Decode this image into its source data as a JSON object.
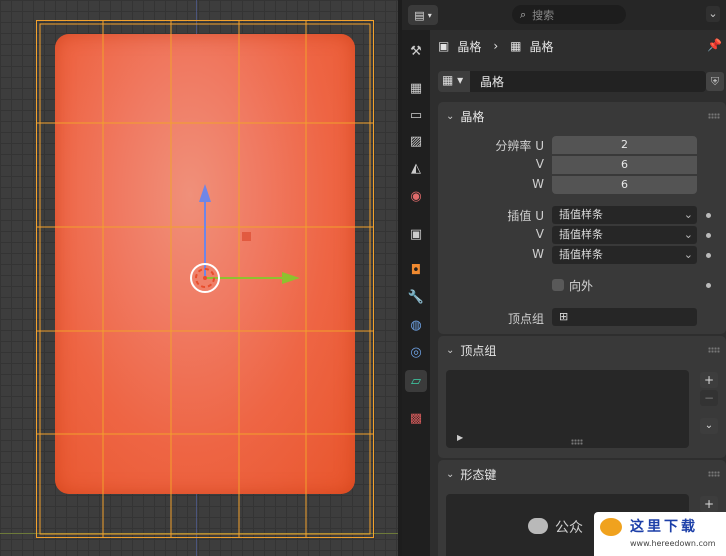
{
  "search": {
    "placeholder": "搜索"
  },
  "breadcrumb": {
    "object": "晶格",
    "data": "晶格"
  },
  "datablock": {
    "name": "晶格"
  },
  "lattice_panel": {
    "title": "晶格",
    "resolution_u_label": "分辨率 U",
    "resolution_u": "2",
    "resolution_v_label": "V",
    "resolution_v": "6",
    "resolution_w_label": "W",
    "resolution_w": "6",
    "interp_u_label": "插值 U",
    "interp_u": "插值样条",
    "interp_v_label": "V",
    "interp_v": "插值样条",
    "interp_w_label": "W",
    "interp_w": "插值样条",
    "outside_label": "向外",
    "vertex_group_label": "顶点组"
  },
  "vertex_groups_panel": {
    "title": "顶点组"
  },
  "shape_keys_panel": {
    "title": "形态键"
  },
  "watermark": {
    "wechat_text": "公众",
    "site_text": "这里下载",
    "site_url": "www.hereedown.com"
  },
  "colors": {
    "accent": "#e8552b",
    "lattice": "#f2a12c",
    "active_tab": "#3b3b3b"
  }
}
